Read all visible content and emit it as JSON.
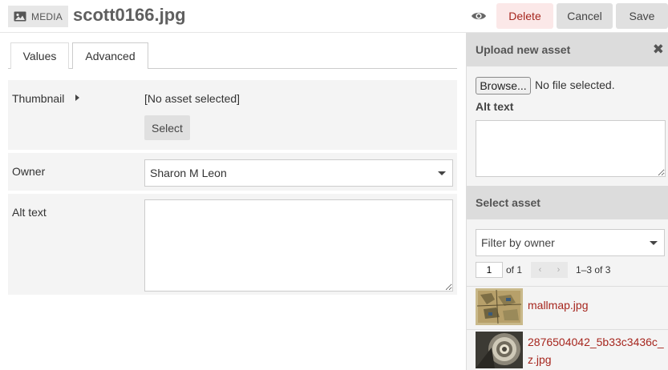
{
  "header": {
    "badge_label": "MEDIA",
    "title": "scott0166.jpg",
    "delete_label": "Delete",
    "cancel_label": "Cancel",
    "save_label": "Save"
  },
  "tabs": [
    {
      "label": "Values"
    },
    {
      "label": "Advanced"
    }
  ],
  "form": {
    "thumbnail": {
      "label": "Thumbnail",
      "status": "[No asset selected]",
      "select_label": "Select"
    },
    "owner": {
      "label": "Owner",
      "value": "Sharon M Leon"
    },
    "alt_text": {
      "label": "Alt text",
      "value": ""
    }
  },
  "sidebar": {
    "upload": {
      "title": "Upload new asset",
      "close_glyph": "✖",
      "browse_label": "Browse...",
      "no_file_text": "No file selected.",
      "alt_label": "Alt text"
    },
    "select": {
      "title": "Select asset",
      "filter_placeholder": "Filter by owner",
      "page_value": "1",
      "of_label": "of 1",
      "prev_glyph": "‹",
      "next_glyph": "›",
      "count_label": "1–3 of 3",
      "assets": [
        {
          "name": "mallmap.jpg"
        },
        {
          "name": "2876504042_5b33c3436c_z.jpg"
        }
      ]
    }
  },
  "colors": {
    "accent_red": "#a6261e",
    "delete_bg": "#fbe8e8",
    "panel_bg": "#f4f4f4",
    "sidebar_header_bg": "#dcdcdc"
  },
  "icons": {
    "badge": "image-icon",
    "preview": "eye-icon",
    "close": "close-icon"
  }
}
